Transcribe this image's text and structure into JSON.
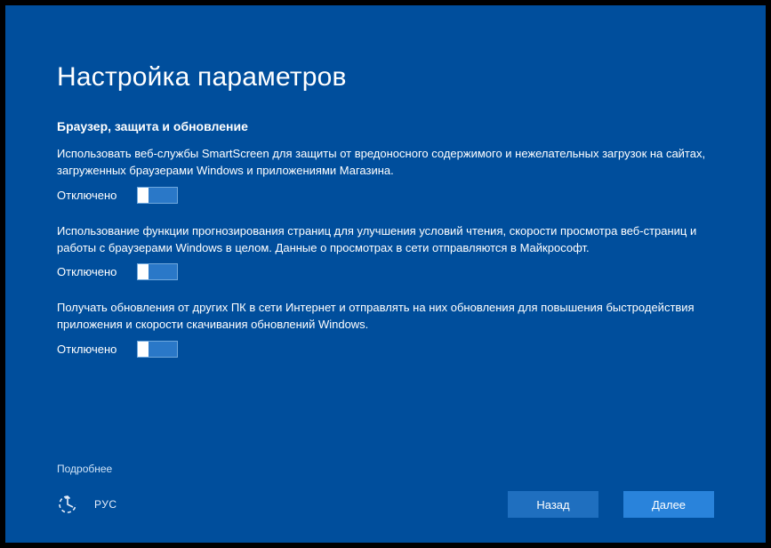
{
  "title": "Настройка параметров",
  "section": {
    "heading": "Браузер, защита и обновление",
    "settings": [
      {
        "desc": "Использовать веб-службы SmartScreen для защиты от вредоносного содержимого и нежелательных загрузок на сайтах, загруженных браузерами Windows и приложениями Магазина.",
        "state": "Отключено"
      },
      {
        "desc": "Использование функции прогнозирования страниц для улучшения условий чтения, скорости просмотра веб-страниц и работы с браузерами Windows в целом. Данные о просмотрах в сети отправляются в Майкрософт.",
        "state": "Отключено"
      },
      {
        "desc": "Получать обновления от других ПК в сети Интернет и отправлять на них обновления для повышения быстродействия приложения и скорости скачивания обновлений Windows.",
        "state": "Отключено"
      }
    ]
  },
  "more_label": "Подробнее",
  "language": "РУС",
  "buttons": {
    "back": "Назад",
    "next": "Далее"
  }
}
